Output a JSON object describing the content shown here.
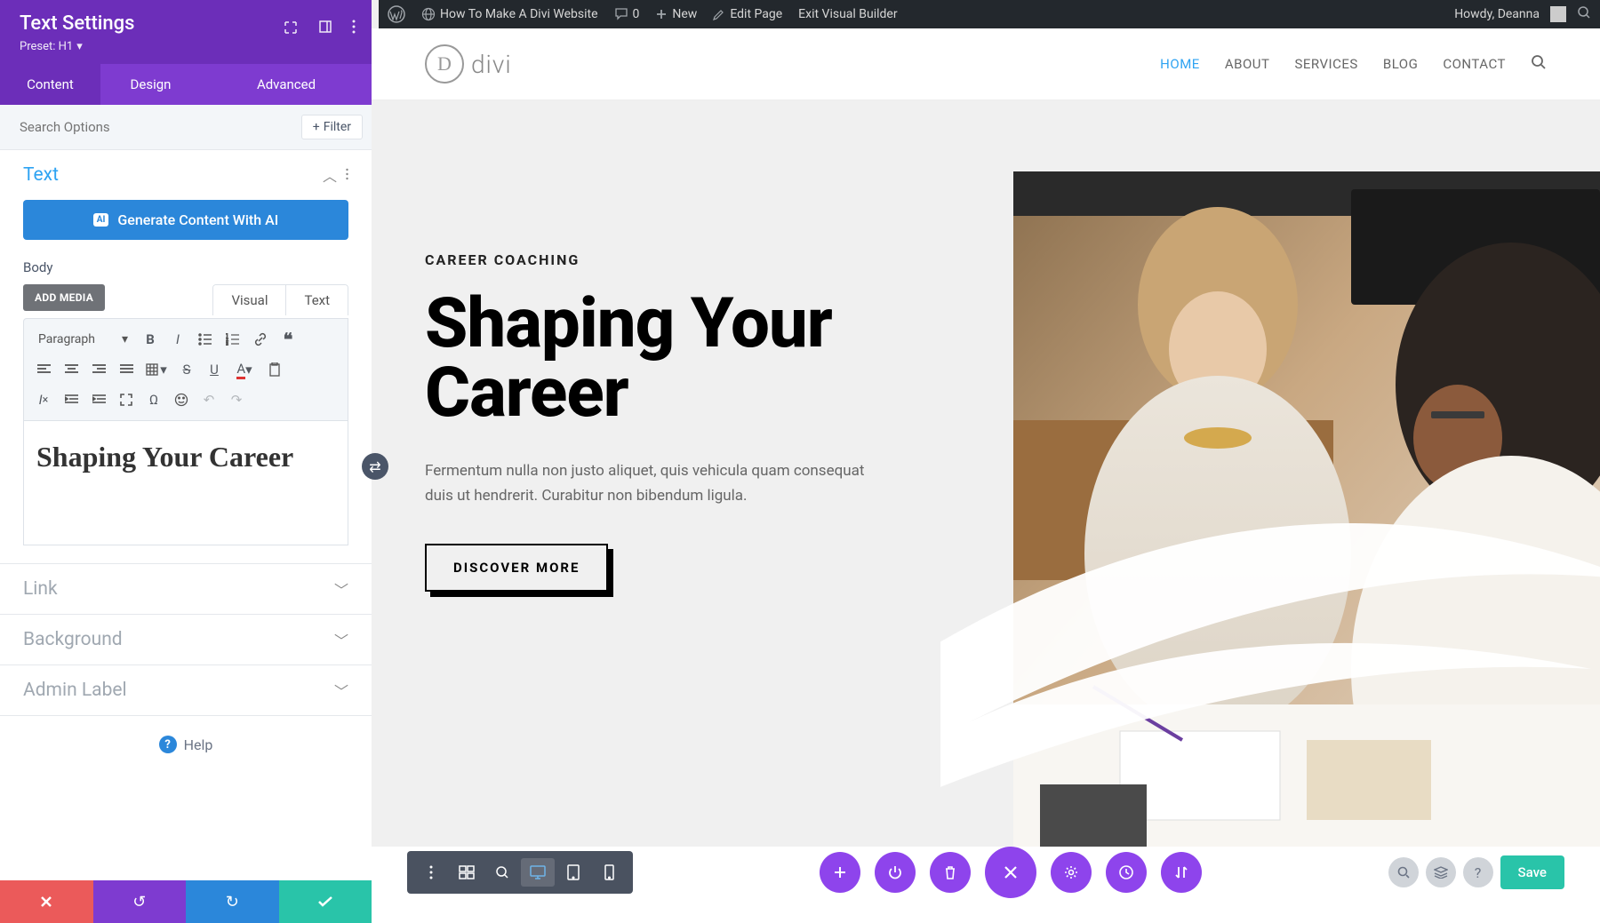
{
  "wp_bar": {
    "site_title": "How To Make A Divi Website",
    "comments_count": "0",
    "new_label": "New",
    "edit_page": "Edit Page",
    "exit_builder": "Exit Visual Builder",
    "greeting": "Howdy, Deanna"
  },
  "panel": {
    "title": "Text Settings",
    "preset": "Preset: H1",
    "tabs": {
      "content": "Content",
      "design": "Design",
      "advanced": "Advanced"
    },
    "search_placeholder": "Search Options",
    "filter_label": "Filter",
    "sections": {
      "text": {
        "label": "Text",
        "ai_button": "Generate Content With AI",
        "body_label": "Body",
        "add_media": "ADD MEDIA",
        "editor_tabs": {
          "visual": "Visual",
          "text": "Text"
        },
        "format_label": "Paragraph",
        "content": "Shaping Your Career"
      },
      "link": "Link",
      "background": "Background",
      "admin_label": "Admin Label"
    },
    "help": "Help"
  },
  "site": {
    "logo_text": "divi",
    "logo_letter": "D",
    "nav": {
      "home": "HOME",
      "about": "ABOUT",
      "services": "SERVICES",
      "blog": "BLOG",
      "contact": "CONTACT"
    },
    "hero": {
      "eyebrow": "CAREER COACHING",
      "heading": "Shaping Your Career",
      "paragraph": "Fermentum nulla non justo aliquet, quis vehicula quam consequat duis ut hendrerit. Curabitur non bibendum ligula.",
      "cta": "DISCOVER MORE"
    }
  },
  "builder_bar": {
    "save": "Save"
  }
}
